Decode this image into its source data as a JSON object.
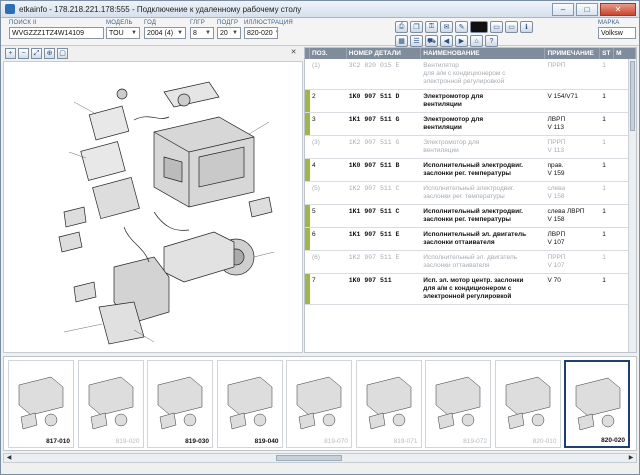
{
  "window": {
    "title": "etkainfo - 178.218.221.178:555 - Подключение к удаленному рабочему столу",
    "minimize": "–",
    "maximize": "□",
    "close": "✕"
  },
  "toolbar": {
    "search": {
      "label": "ПОИСК ІІ",
      "value": "WVGZZZ1TZ4W14109"
    },
    "model": {
      "label": "МОДЕЛЬ",
      "value": "TOU"
    },
    "year": {
      "label": "ГОД",
      "value": "2004 (4)"
    },
    "group": {
      "label": "ГЛГР",
      "value": "8"
    },
    "subgroup": {
      "label": "ПОДГР",
      "value": "20"
    },
    "illustration": {
      "label": "ИЛЛЮСТРАЦИЯ",
      "value": "820-020"
    },
    "brand": {
      "label": "МАРКА",
      "value": "Volksw"
    }
  },
  "table": {
    "headers": [
      "ПОЗ.",
      "НОМЕР ДЕТАЛИ",
      "НАИМЕНОВАНИЕ",
      "ПРИМЕЧАНИЕ",
      "ST",
      "M"
    ],
    "rows": [
      {
        "pos": "(1)",
        "part": "3C2 820 015 E",
        "name": "Вентилятор\nдля а/м с кондиционером с\nэлектронной регулировкой",
        "note": "ПРРП",
        "st": "1",
        "dim": true,
        "active": false
      },
      {
        "pos": "2",
        "part": "1K0 907 511 D",
        "name": "Электромотор для\nвентиляции",
        "note": "V 154/V71",
        "st": "1",
        "dim": false,
        "active": true
      },
      {
        "pos": "3",
        "part": "1K1 907 511 G",
        "name": "Электромотор для\nвентиляции",
        "note": "ЛВРП\nV 113",
        "st": "1",
        "dim": false,
        "active": true
      },
      {
        "pos": "(3)",
        "part": "1K2 907 511 G",
        "name": "Электромотор для\nвентиляции",
        "note": "ПРРП\nV 113",
        "st": "1",
        "dim": true,
        "active": false
      },
      {
        "pos": "4",
        "part": "1K0 907 511 B",
        "name": "Исполнительный электродвиг.\nзаслонки рег. температуры",
        "note": "прав.\nV 159",
        "st": "1",
        "dim": false,
        "active": true
      },
      {
        "pos": "(5)",
        "part": "1K2 907 511 C",
        "name": "Исполнительный электродвиг.\nзаслонки рег. температуры",
        "note": "слева\nV 158",
        "st": "1",
        "dim": true,
        "active": false
      },
      {
        "pos": "5",
        "part": "1K1 907 511 C",
        "name": "Исполнительный электродвиг.\nзаслонки рег. температуры",
        "note": "слева ЛВРП\nV 158",
        "st": "1",
        "dim": false,
        "active": true
      },
      {
        "pos": "6",
        "part": "1K1 907 511 E",
        "name": "Исполнительный эл. двигатель\nзаслонки оттаивателя",
        "note": "ЛВРП\nV 107",
        "st": "1",
        "dim": false,
        "active": true
      },
      {
        "pos": "(6)",
        "part": "1K2 907 511 E",
        "name": "Исполнительный эл. двигатель\nзаслонки оттаивателя",
        "note": "ПРРП\nV 107",
        "st": "1",
        "dim": true,
        "active": false
      },
      {
        "pos": "7",
        "part": "1K0 907 511",
        "name": "Исп. эл. мотор центр. заслонки\nдля а/м с кондиционером с\nэлектронной регулировкой",
        "note": "V 70",
        "st": "1",
        "dim": false,
        "active": true
      }
    ]
  },
  "thumbnails": [
    {
      "label": "817-010",
      "selected": false,
      "dim": false
    },
    {
      "label": "819-020",
      "selected": false,
      "dim": true
    },
    {
      "label": "819-030",
      "selected": false,
      "dim": false
    },
    {
      "label": "819-040",
      "selected": false,
      "dim": false
    },
    {
      "label": "819-070",
      "selected": false,
      "dim": true
    },
    {
      "label": "819-071",
      "selected": false,
      "dim": true
    },
    {
      "label": "819-072",
      "selected": false,
      "dim": true
    },
    {
      "label": "820-010",
      "selected": false,
      "dim": true
    },
    {
      "label": "820-020",
      "selected": true,
      "dim": false
    }
  ],
  "icons": {
    "toolbar_row1": [
      "print-icon",
      "copy-icon",
      "lock-icon",
      "mail-icon",
      "black-box-icon",
      "window-icon",
      "window-icon",
      "info-icon"
    ],
    "toolbar_row2": [
      "grid-icon",
      "list-icon",
      "cart-icon",
      "back-icon",
      "forward-icon",
      "home-icon",
      "help-icon"
    ]
  }
}
